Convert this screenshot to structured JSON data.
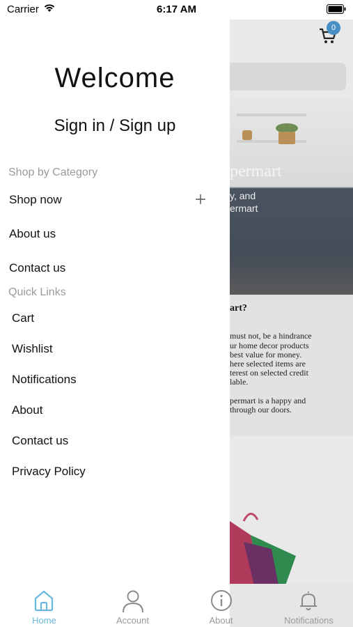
{
  "status_bar": {
    "carrier": "Carrier",
    "time": "6:17 AM",
    "icons": [
      "wifi-icon",
      "battery-icon"
    ]
  },
  "drawer": {
    "welcome": "Welcome",
    "sign_in": "Sign in / Sign up",
    "shop_section_label": "Shop by Category",
    "main_items": [
      {
        "label": "Shop now",
        "icon": "plus-icon"
      },
      {
        "label": "About us"
      },
      {
        "label": "Contact us"
      }
    ],
    "quick_links_label": "Quick Links",
    "quick_links": [
      "Cart",
      "Wishlist",
      "Notifications",
      "About",
      "Contact us",
      "Privacy Policy"
    ]
  },
  "background_page": {
    "cart_badge": "0",
    "brand_partial": "permart",
    "tagline_lines": [
      "y, and",
      "ermart"
    ],
    "card_title": "art?",
    "card_lines": [
      "must not, be a hindrance",
      "ur home decor products",
      "best value for money.",
      "here selected items are",
      "terest on selected credit",
      "lable.",
      "",
      "permart is a happy and",
      "through our doors."
    ]
  },
  "tab_bar": {
    "tabs": [
      {
        "label": "Home",
        "icon": "home-icon",
        "active": true
      },
      {
        "label": "Account",
        "icon": "account-icon",
        "active": false
      },
      {
        "label": "About",
        "icon": "info-icon",
        "active": false
      },
      {
        "label": "Notifications",
        "icon": "bell-icon",
        "active": false
      }
    ],
    "colors": {
      "active": "#69b7dd",
      "inactive": "#9a9a9a"
    }
  }
}
